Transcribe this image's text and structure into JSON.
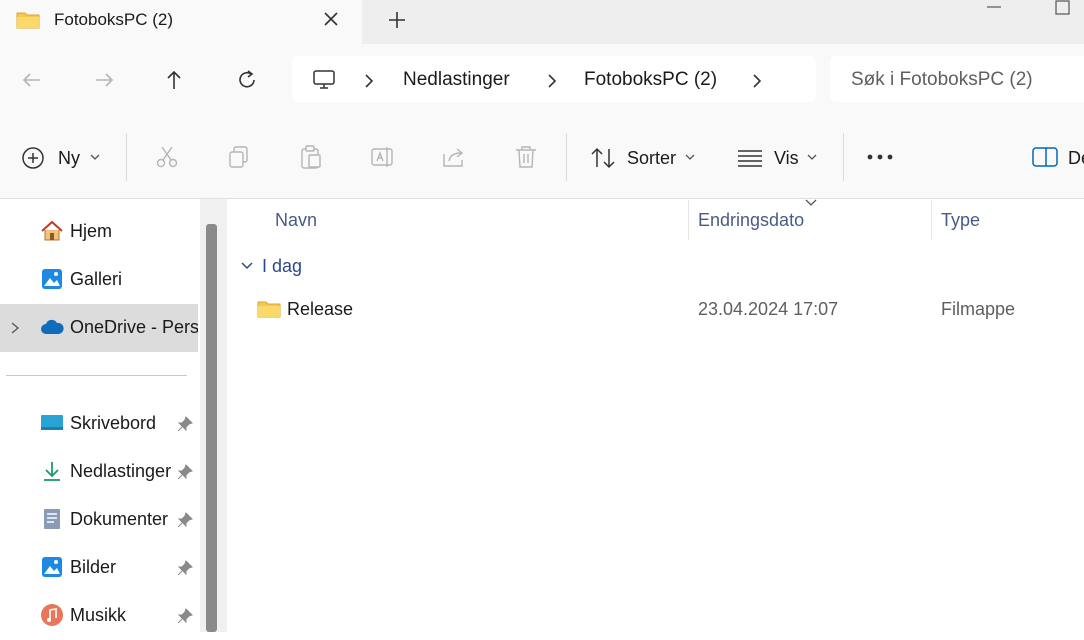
{
  "tab": {
    "title": "FotoboksPC (2)",
    "close_icon": "close-icon",
    "new_icon": "plus-icon"
  },
  "address": {
    "crumbs": [
      "Nedlastinger",
      "FotoboksPC (2)"
    ]
  },
  "search": {
    "placeholder": "Søk i FotoboksPC (2)"
  },
  "commands": {
    "new_label": "Ny",
    "sort_label": "Sorter",
    "view_label": "Vis",
    "details_label": "De"
  },
  "sidebar": {
    "items": [
      {
        "label": "Hjem"
      },
      {
        "label": "Galleri"
      },
      {
        "label": "OneDrive - Perso"
      }
    ],
    "pinned": [
      {
        "label": "Skrivebord"
      },
      {
        "label": "Nedlastinger"
      },
      {
        "label": "Dokumenter"
      },
      {
        "label": "Bilder"
      },
      {
        "label": "Musikk"
      }
    ]
  },
  "columns": {
    "name": "Navn",
    "date": "Endringsdato",
    "type": "Type"
  },
  "group": {
    "label": "I dag"
  },
  "rows": [
    {
      "name": "Release",
      "date": "23.04.2024 17:07",
      "type": "Filmappe"
    }
  ],
  "colors": {
    "accent": "#0067c0",
    "folder": "#f2c94c",
    "selection": "#dcdcdc"
  }
}
